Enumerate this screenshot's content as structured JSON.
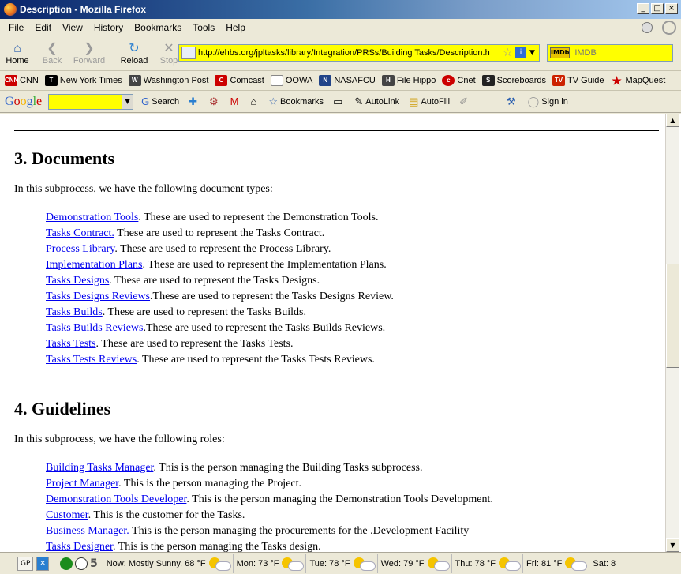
{
  "window": {
    "title": "Description - Mozilla Firefox"
  },
  "menu": [
    "File",
    "Edit",
    "View",
    "History",
    "Bookmarks",
    "Tools",
    "Help"
  ],
  "nav": {
    "home": "Home",
    "back": "Back",
    "forward": "Forward",
    "reload": "Reload",
    "stop": "Stop",
    "url": "http://ehbs.org/jpltasks/library/Integration/PRSs/Building Tasks/Description.h",
    "search_placeholder": "IMDB",
    "search_engine": "IMDb"
  },
  "bookmarks": [
    {
      "label": "CNN",
      "icon": "cnn-icon",
      "color": "#cc0000"
    },
    {
      "label": "New York Times",
      "icon": "nyt-icon",
      "color": "#000000"
    },
    {
      "label": "Washington Post",
      "icon": "wapo-icon",
      "color": "#333333"
    },
    {
      "label": "Comcast",
      "icon": "comcast-icon",
      "color": "#cc0000"
    },
    {
      "label": "OOWA",
      "icon": "page-icon",
      "color": "#ffffff"
    },
    {
      "label": "NASAFCU",
      "icon": "nasa-icon",
      "color": "#224488"
    },
    {
      "label": "File Hippo",
      "icon": "filehippo-icon",
      "color": "#444444"
    },
    {
      "label": "Cnet",
      "icon": "cnet-icon",
      "color": "#cc0000"
    },
    {
      "label": "Scoreboards",
      "icon": "scoreboards-icon",
      "color": "#222222"
    },
    {
      "label": "TV Guide",
      "icon": "tvguide-icon",
      "color": "#cc2200"
    },
    {
      "label": "MapQuest",
      "icon": "mapquest-icon",
      "color": "#cc0000"
    }
  ],
  "google_toolbar": {
    "logo": "Google",
    "search": "Search",
    "bookmarks": "Bookmarks",
    "autolink": "AutoLink",
    "autofill": "AutoFill",
    "signin": "Sign in"
  },
  "content": {
    "documents": {
      "heading": "3. Documents",
      "intro": "In this subprocess, we have the following document types:",
      "items": [
        {
          "link": "Demonstration Tools",
          "text": ". These are used to represent the Demonstration Tools."
        },
        {
          "link": "Tasks Contract.",
          "text": " These are used to represent the Tasks Contract."
        },
        {
          "link": "Process Library",
          "text": ". These are used to represent the Process Library."
        },
        {
          "link": "Implementation Plans",
          "text": ". These are used to represent the Implementation Plans."
        },
        {
          "link": "Tasks Designs",
          "text": ". These are used to represent the Tasks Designs."
        },
        {
          "link": "Tasks Designs Reviews",
          "text": ".These are used to represent the Tasks Designs Review."
        },
        {
          "link": "Tasks Builds",
          "text": ". These are used to represent the Tasks Builds."
        },
        {
          "link": "Tasks Builds Reviews",
          "text": ".These are used to represent the Tasks Builds Reviews."
        },
        {
          "link": "Tasks Tests",
          "text": ". These are used to represent the Tasks Tests."
        },
        {
          "link": "Tasks Tests Reviews",
          "text": ". These are used to represent the Tasks Tests Reviews."
        }
      ]
    },
    "guidelines": {
      "heading": "4. Guidelines",
      "intro": "In this subprocess, we have the following roles:",
      "items": [
        {
          "link": "Building Tasks Manager",
          "text": ". This is the person managing the Building Tasks subprocess."
        },
        {
          "link": "Project Manager",
          "text": ". This is the person managing the Project."
        },
        {
          "link": "Demonstration Tools Developer",
          "text": ". This is the person managing the Demonstration Tools Development."
        },
        {
          "link": "Customer",
          "text": ". This is the customer for the Tasks."
        },
        {
          "link": "Business Manager.",
          "text": " This is the person managing the procurements for the .Development Facility"
        },
        {
          "link": "Tasks Designer",
          "text": ". This is the person managing the Tasks design."
        }
      ]
    }
  },
  "status": {
    "gp": "GP",
    "count": "5",
    "weather": [
      "Now: Mostly Sunny, 68 °F",
      "Mon: 73 °F",
      "Tue: 78 °F",
      "Wed: 79 °F",
      "Thu: 78 °F",
      "Fri: 81 °F",
      "Sat: 8"
    ]
  }
}
